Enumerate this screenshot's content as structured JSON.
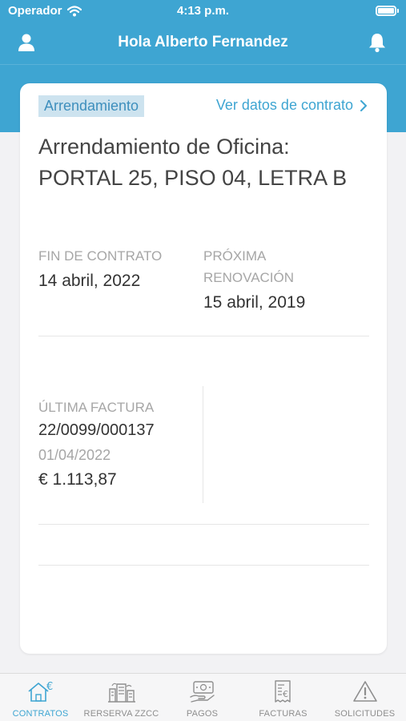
{
  "status_bar": {
    "carrier": "Operador",
    "time": "4:13 p.m."
  },
  "header": {
    "greeting": "Hola Alberto Fernandez"
  },
  "contract": {
    "tag": "Arrendamiento",
    "view_link": "Ver datos de contrato",
    "title": "Arrendamiento de Oficina: PORTAL 25, PISO 04, LETRA B",
    "end_label": "FIN DE CONTRATO",
    "end_value": "14 abril, 2022",
    "renewal_label": "PRÓXIMA RENOVACIÓN",
    "renewal_value": "15 abril, 2019",
    "invoice_label": "ÚLTIMA FACTURA",
    "invoice_number": "22/0099/000137",
    "invoice_date": "01/04/2022",
    "invoice_amount": "€ 1.113,87"
  },
  "tabs": [
    {
      "label": "CONTRATOS",
      "icon": "house-euro-icon",
      "active": true
    },
    {
      "label": "RERSERVA ZZCC",
      "icon": "facilities-icon",
      "active": false
    },
    {
      "label": "PAGOS",
      "icon": "payment-hand-icon",
      "active": false
    },
    {
      "label": "FACTURAS",
      "icon": "invoice-euro-icon",
      "active": false
    },
    {
      "label": "SOLICITUDES",
      "icon": "warning-triangle-icon",
      "active": false
    }
  ],
  "colors": {
    "accent": "#3ea5d2",
    "tag_bg": "#cde3ef",
    "inactive": "#8e8e8e"
  }
}
